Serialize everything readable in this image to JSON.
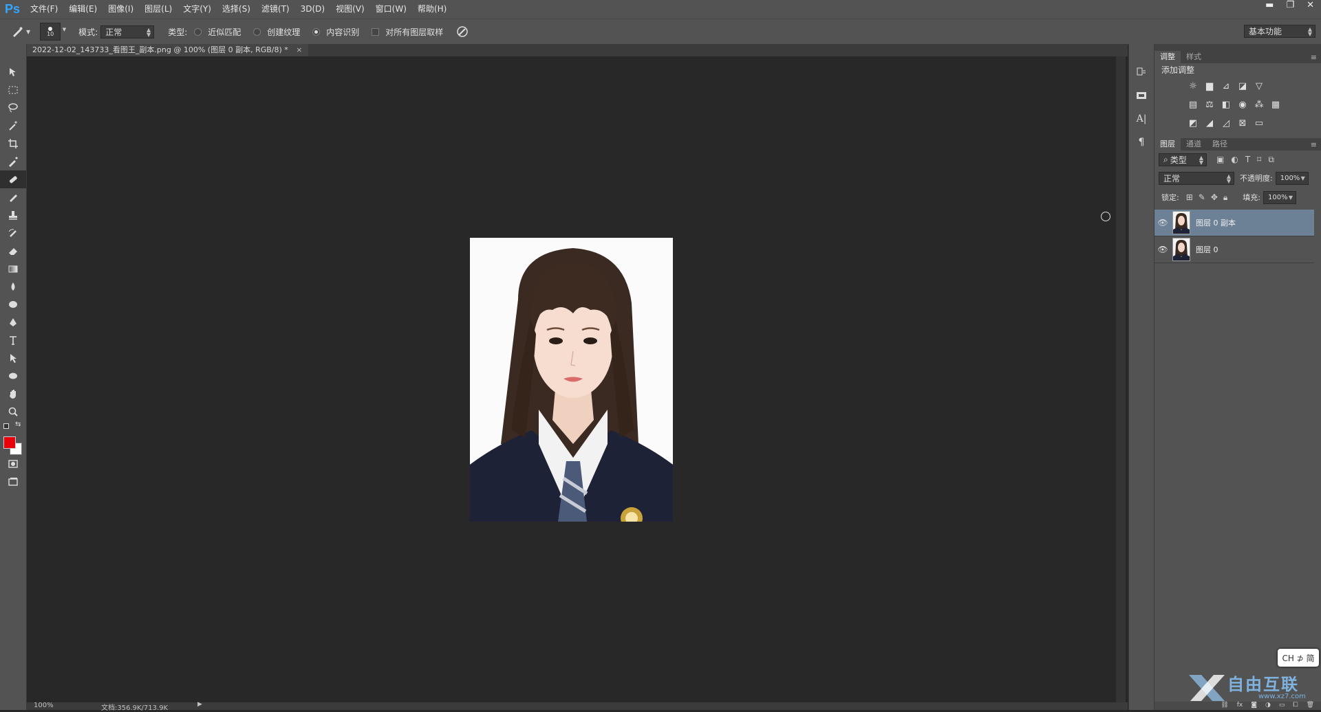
{
  "app": {
    "logo": "Ps"
  },
  "menu": [
    "文件(F)",
    "编辑(E)",
    "图像(I)",
    "图层(L)",
    "文字(Y)",
    "选择(S)",
    "滤镜(T)",
    "3D(D)",
    "视图(V)",
    "窗口(W)",
    "帮助(H)"
  ],
  "window_controls": {
    "minimize": "▬",
    "restore": "❐",
    "close": "✕"
  },
  "options": {
    "brush_size": "10",
    "mode_label": "模式:",
    "mode_value": "正常",
    "type_label": "类型:",
    "type_options": [
      {
        "label": "近似匹配",
        "selected": false
      },
      {
        "label": "创建纹理",
        "selected": false
      },
      {
        "label": "内容识别",
        "selected": true
      }
    ],
    "sample_all_label": "对所有图层取样",
    "workspace": "基本功能"
  },
  "document": {
    "tab_title": "2022-12-02_143733_看图王_副本.png @ 100% (图层 0 副本, RGB/8) *",
    "close_glyph": "×",
    "zoom": "100%",
    "doc_info": "文档:356.9K/713.9K"
  },
  "tools": [
    "move-tool",
    "marquee-tool",
    "lasso-tool",
    "magic-wand-tool",
    "crop-tool",
    "eyedropper-tool",
    "spot-healing-tool",
    "brush-tool",
    "clone-stamp-tool",
    "history-brush-tool",
    "eraser-tool",
    "gradient-tool",
    "blur-tool",
    "dodge-tool",
    "pen-tool",
    "type-tool",
    "path-selection-tool",
    "ellipse-tool",
    "hand-tool",
    "zoom-tool"
  ],
  "colors": {
    "foreground": "#e8000b",
    "background": "#ffffff",
    "selected_layer": "#6c8096",
    "ui_dark": "#282828",
    "ui_panel": "#535353"
  },
  "panels": {
    "adjust_tabs": [
      "调整",
      "样式"
    ],
    "add_adjustment": "添加调整",
    "layer_tabs": [
      "图层",
      "通道",
      "路径"
    ],
    "filter_kind": "类型",
    "blend_mode": "正常",
    "opacity_label": "不透明度:",
    "opacity_value": "100%",
    "lock_label": "锁定:",
    "fill_label": "填充:",
    "fill_value": "100%",
    "layers": [
      {
        "name": "图层 0 副本",
        "selected": true
      },
      {
        "name": "图层 0",
        "selected": false
      }
    ]
  },
  "ime": "CH ⊅ 简",
  "watermark": {
    "brand": "自由互联",
    "url": "www.xz7.com"
  }
}
